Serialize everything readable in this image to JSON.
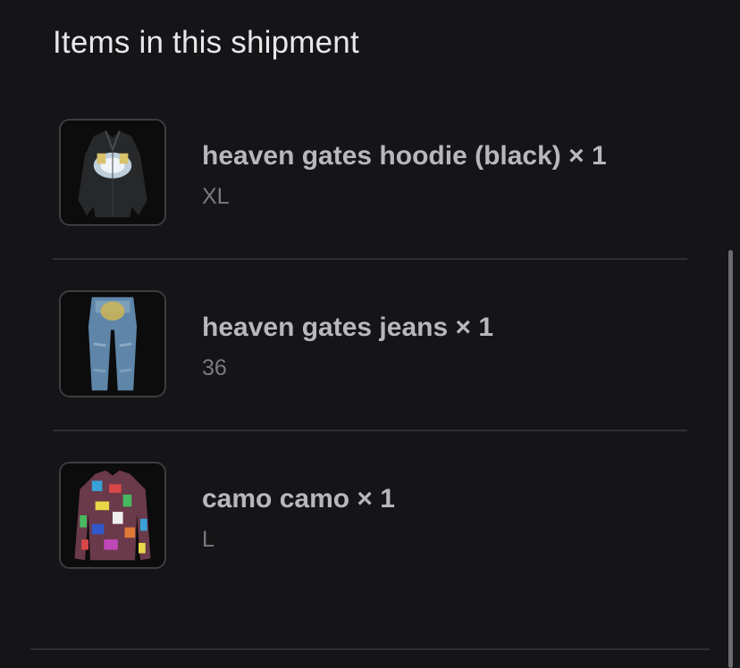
{
  "section": {
    "title": "Items in this shipment"
  },
  "items": [
    {
      "name": "heaven gates hoodie (black) × 1",
      "variant": "XL",
      "image_icon": "hoodie-image"
    },
    {
      "name": "heaven gates jeans × 1",
      "variant": "36",
      "image_icon": "jeans-image"
    },
    {
      "name": "camo camo × 1",
      "variant": "L",
      "image_icon": "sweater-image"
    }
  ]
}
